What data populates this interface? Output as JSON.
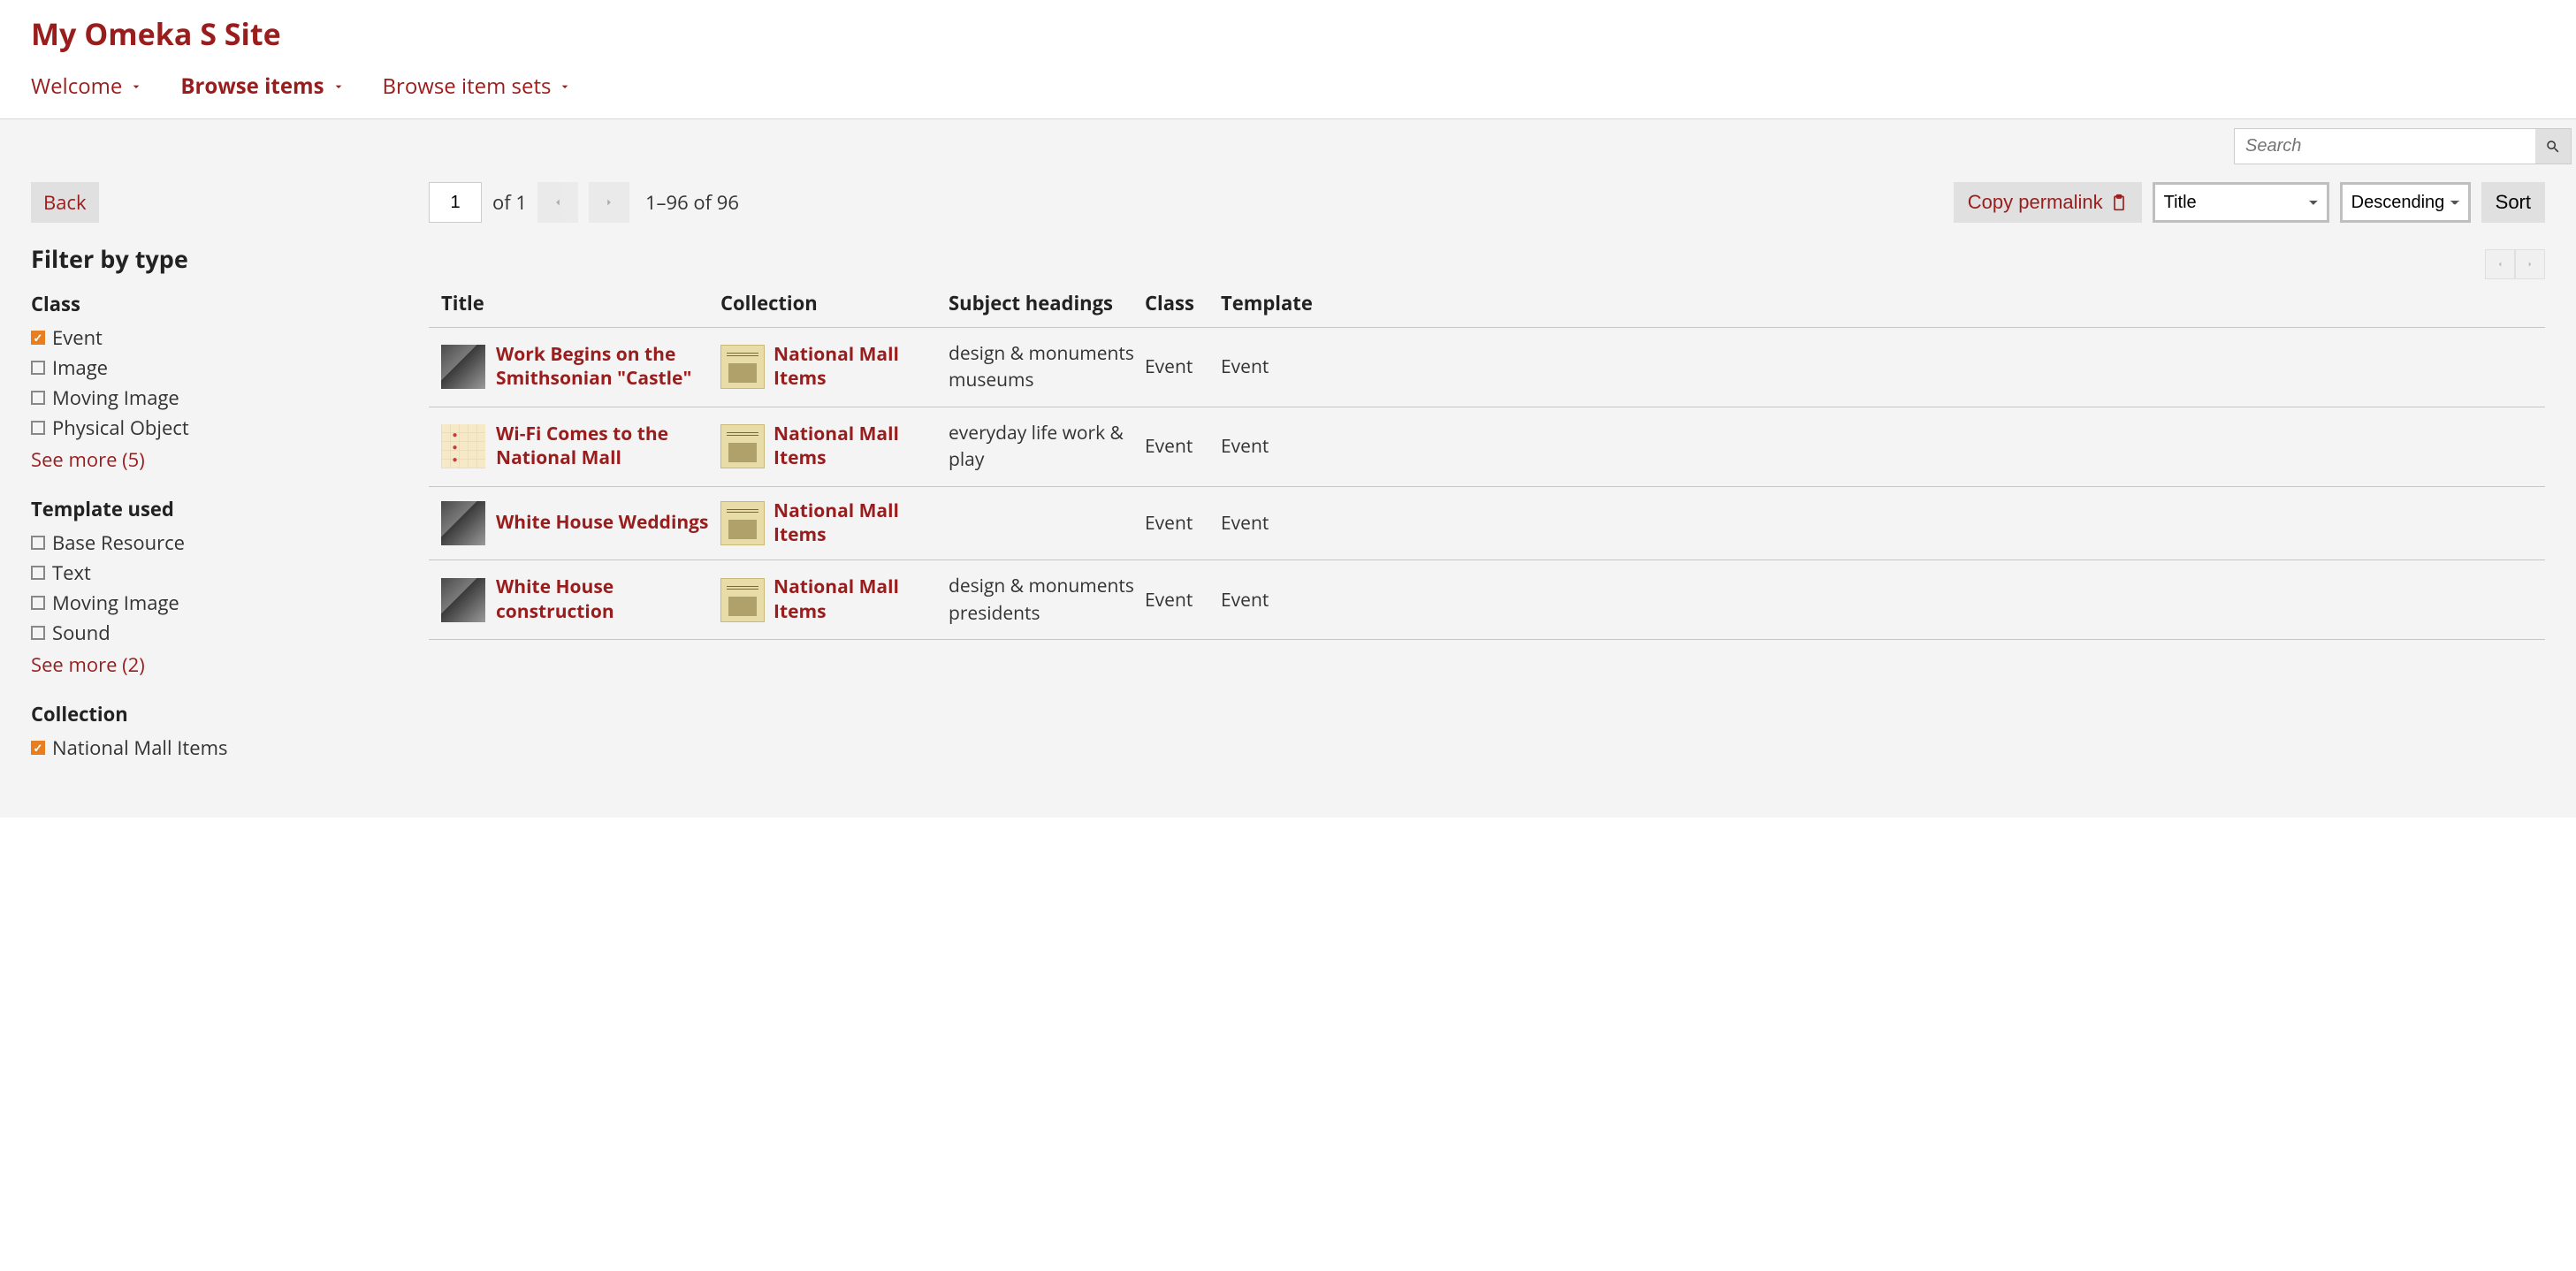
{
  "site_title": "My Omeka S Site",
  "nav": [
    {
      "label": "Welcome",
      "active": false
    },
    {
      "label": "Browse items",
      "active": true
    },
    {
      "label": "Browse item sets",
      "active": false
    }
  ],
  "search": {
    "placeholder": "Search"
  },
  "back_label": "Back",
  "sidebar": {
    "heading": "Filter by type",
    "groups": [
      {
        "label": "Class",
        "options": [
          {
            "label": "Event",
            "checked": true
          },
          {
            "label": "Image",
            "checked": false
          },
          {
            "label": "Moving Image",
            "checked": false
          },
          {
            "label": "Physical Object",
            "checked": false
          }
        ],
        "see_more": "See more (5)"
      },
      {
        "label": "Template used",
        "options": [
          {
            "label": "Base Resource",
            "checked": false
          },
          {
            "label": "Text",
            "checked": false
          },
          {
            "label": "Moving Image",
            "checked": false
          },
          {
            "label": "Sound",
            "checked": false
          }
        ],
        "see_more": "See more (2)"
      },
      {
        "label": "Collection",
        "options": [
          {
            "label": "National Mall Items",
            "checked": true
          }
        ]
      }
    ]
  },
  "toolbar": {
    "page_current": "1",
    "page_of": "of 1",
    "range": "1–96 of 96",
    "copy_permalink": "Copy permalink",
    "sort_by": "Title",
    "sort_dir": "Descending",
    "sort_btn": "Sort"
  },
  "columns": {
    "title": "Title",
    "collection": "Collection",
    "subject": "Subject headings",
    "class": "Class",
    "template": "Template"
  },
  "rows": [
    {
      "thumb": "bw",
      "title": "Work Begins on the Smithsonian \"Castle\"",
      "collection": "National Mall Items",
      "subject": "design & monuments museums",
      "class": "Event",
      "template": "Event"
    },
    {
      "thumb": "map",
      "title": "Wi-Fi Comes to the National Mall",
      "collection": "National Mall Items",
      "subject": "everyday life work & play",
      "class": "Event",
      "template": "Event"
    },
    {
      "thumb": "bw",
      "title": "White House Weddings",
      "collection": "National Mall Items",
      "subject": "",
      "class": "Event",
      "template": "Event"
    },
    {
      "thumb": "bw",
      "title": "White House construction",
      "collection": "National Mall Items",
      "subject": "design & monuments presidents",
      "class": "Event",
      "template": "Event"
    }
  ]
}
